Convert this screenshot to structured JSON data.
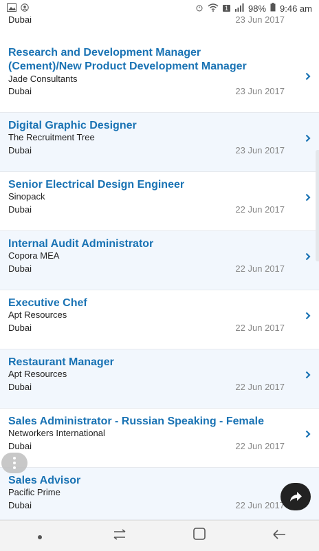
{
  "status_bar": {
    "battery": "98%",
    "time": "9:46 am",
    "sim_label": "1"
  },
  "partial_top": {
    "location": "Dubai",
    "date": "23 Jun 2017"
  },
  "jobs": [
    {
      "title_line1": "Research and Development Manager",
      "title_line2": "(Cement)/New Product Development Manager",
      "company": "Jade Consultants",
      "location": "Dubai",
      "date": "23 Jun 2017"
    },
    {
      "title_line1": "Digital Graphic Designer",
      "company": "The Recruitment Tree",
      "location": "Dubai",
      "date": "23 Jun 2017"
    },
    {
      "title_line1": "Senior Electrical Design Engineer",
      "company": "Sinopack",
      "location": "Dubai",
      "date": "22 Jun 2017"
    },
    {
      "title_line1": "Internal Audit Administrator",
      "company": "Copora MEA",
      "location": "Dubai",
      "date": "22 Jun 2017"
    },
    {
      "title_line1": "Executive Chef",
      "company": "Apt Resources",
      "location": "Dubai",
      "date": "22 Jun 2017"
    },
    {
      "title_line1": "Restaurant Manager",
      "company": "Apt Resources",
      "location": "Dubai",
      "date": "22 Jun 2017"
    },
    {
      "title_line1": "Sales Administrator - Russian Speaking - Female",
      "company": "Networkers International",
      "location": "Dubai",
      "date": "22 Jun 2017"
    },
    {
      "title_line1": "Sales Advisor",
      "company": "Pacific Prime",
      "location": "Dubai",
      "date": "22 Jun 2017"
    }
  ],
  "icons": {
    "chevron": "chevron-right-icon",
    "share": "share-icon",
    "more": "more-vertical-icon"
  },
  "colors": {
    "title": "#1a73b4",
    "alt_row": "#f2f7fd"
  }
}
